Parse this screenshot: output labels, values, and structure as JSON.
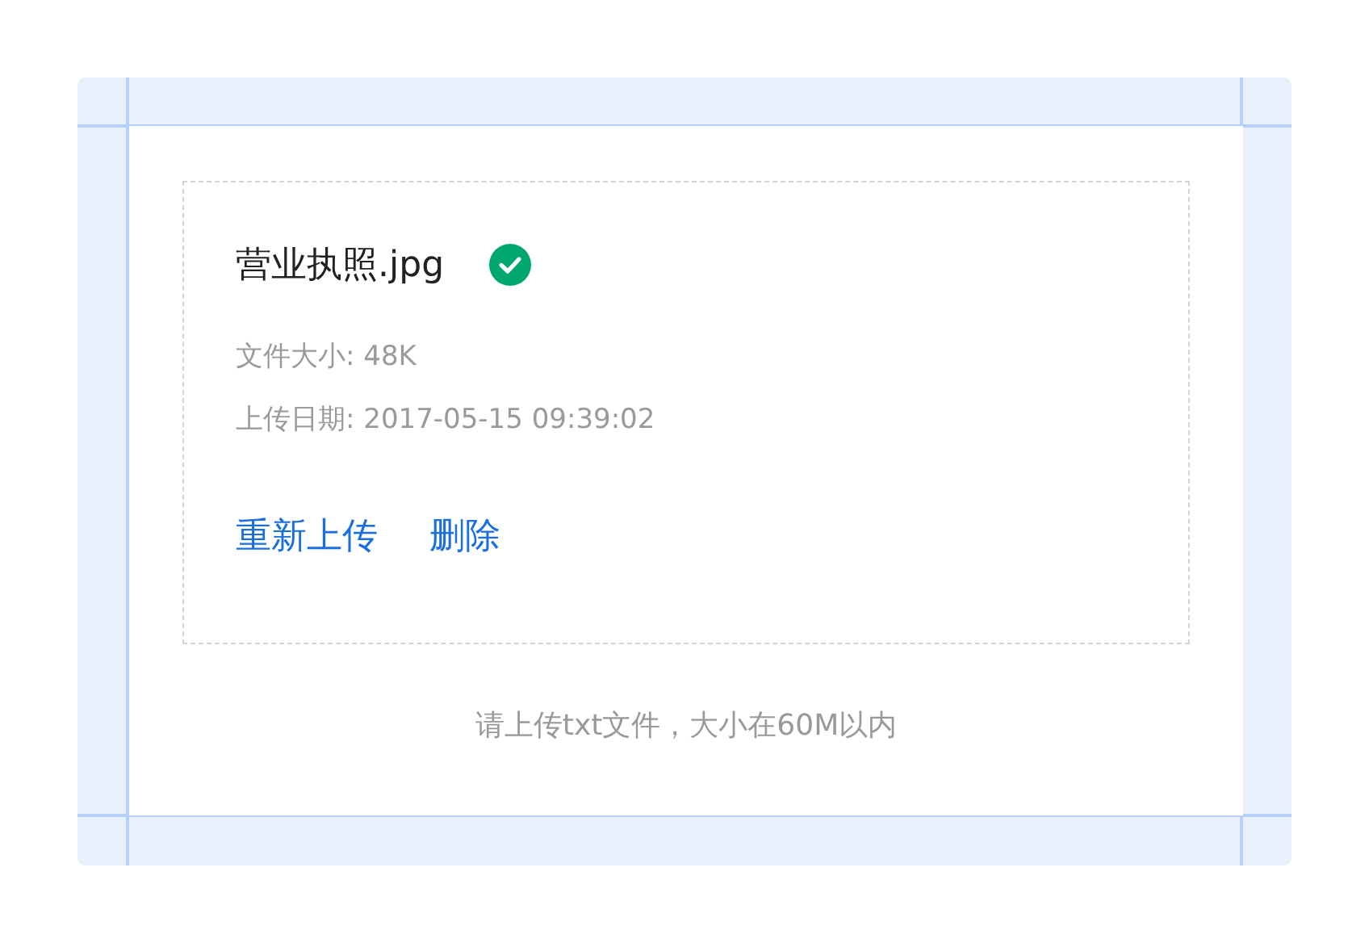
{
  "file": {
    "name": "营业执照.jpg",
    "uploaded": true,
    "details": [
      "文件大小: 48K",
      "上传日期: 2017-05-15 09:39:02"
    ],
    "actions": [
      "重新上传",
      "删除"
    ]
  },
  "hint": "请上传txt文件，大小在60M以内"
}
